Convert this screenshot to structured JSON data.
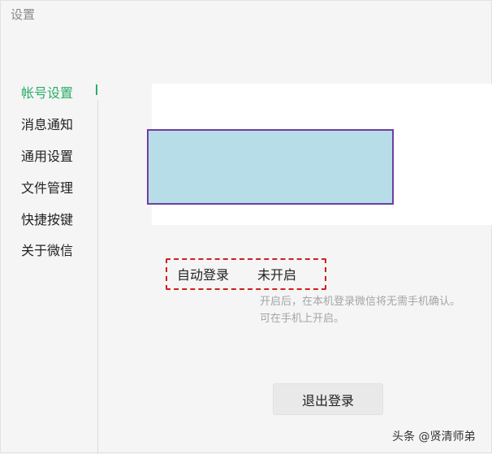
{
  "window": {
    "title": "设置"
  },
  "sidebar": {
    "items": [
      {
        "label": "帐号设置",
        "active": true
      },
      {
        "label": "消息通知"
      },
      {
        "label": "通用设置"
      },
      {
        "label": "文件管理"
      },
      {
        "label": "快捷按键"
      },
      {
        "label": "关于微信"
      }
    ]
  },
  "account": {
    "auto_login": {
      "label": "自动登录",
      "value": "未开启",
      "hint_lines": [
        "开启后，在本机登录微信将无需手机确认。",
        "可在手机上开启。"
      ]
    },
    "logout_label": "退出登录"
  },
  "watermark": "头条 @贤清师弟",
  "colors": {
    "accent": "#2aae67",
    "redacted_fill": "#b7dde8",
    "redacted_border": "#6e3fa0",
    "highlight_border": "#cf1f1f"
  }
}
